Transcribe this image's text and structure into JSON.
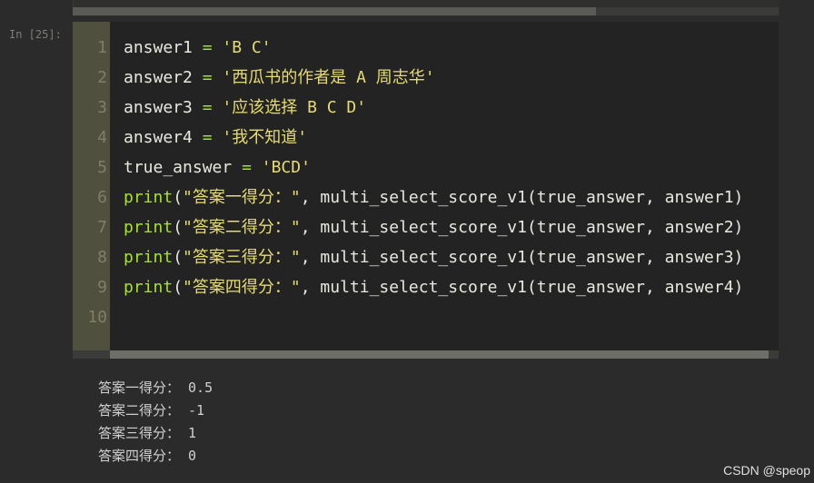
{
  "prompt": "In [25]:",
  "line_numbers": [
    "1",
    "2",
    "3",
    "4",
    "5",
    "6",
    "7",
    "8",
    "9",
    "10"
  ],
  "code": {
    "l1": {
      "v": "answer1",
      "eq": "=",
      "s": "'B C'"
    },
    "l2": {
      "v": "answer2",
      "eq": "=",
      "s": "'西瓜书的作者是 A 周志华'"
    },
    "l3": {
      "v": "answer3",
      "eq": "=",
      "s": "'应该选择 B C D'"
    },
    "l4": {
      "v": "answer4",
      "eq": "=",
      "s": "'我不知道'"
    },
    "l5": {
      "v": "true_answer",
      "eq": "=",
      "s": "'BCD'"
    },
    "l6": {
      "f": "print",
      "a": "(",
      "s": "\"答案一得分：\"",
      "rest": ", multi_select_score_v1(true_answer, answer1)"
    },
    "l7": {
      "f": "print",
      "a": "(",
      "s": "\"答案二得分：\"",
      "rest": ", multi_select_score_v1(true_answer, answer2)"
    },
    "l8": {
      "f": "print",
      "a": "(",
      "s": "\"答案三得分：\"",
      "rest": ", multi_select_score_v1(true_answer, answer3)"
    },
    "l9": {
      "f": "print",
      "a": "(",
      "s": "\"答案四得分：\"",
      "rest": ", multi_select_score_v1(true_answer, answer4)"
    }
  },
  "output": [
    "答案一得分： 0.5",
    "答案二得分： -1",
    "答案三得分： 1",
    "答案四得分： 0"
  ],
  "watermark": "CSDN @speop"
}
